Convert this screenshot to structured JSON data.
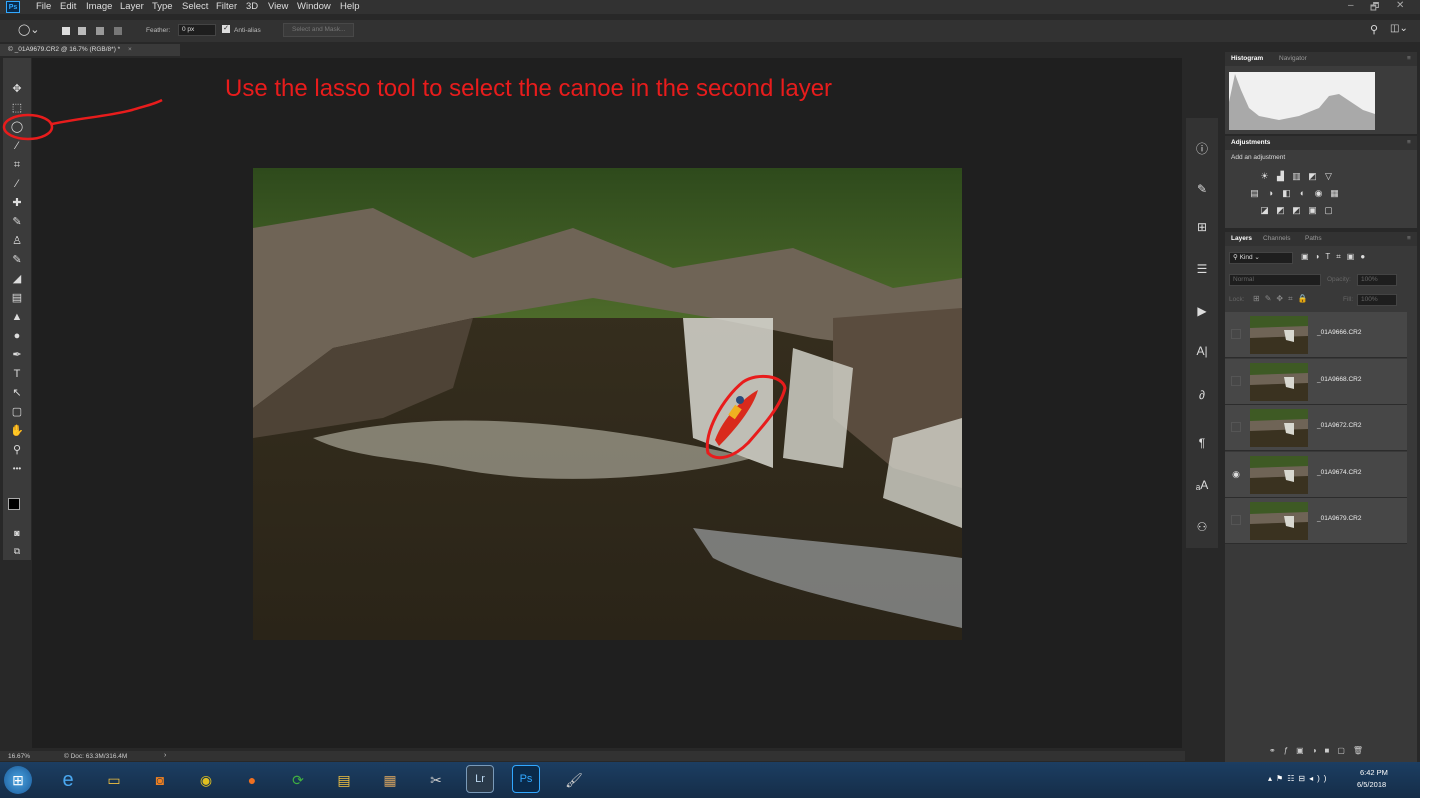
{
  "app": {
    "name": "Ps",
    "menu": [
      "File",
      "Edit",
      "Image",
      "Layer",
      "Type",
      "Select",
      "Filter",
      "3D",
      "View",
      "Window",
      "Help"
    ],
    "window_controls": [
      "–",
      "🗗",
      "✕"
    ]
  },
  "options_bar": {
    "feather_label": "Feather:",
    "feather_value": "0 px",
    "antialias_label": "Anti-alias",
    "antialias_checked": true,
    "select_mask_label": "Select and Mask..."
  },
  "document_tab": {
    "title": "© _01A9679.CR2 @ 16.7% (RGB/8*) *",
    "close": "×"
  },
  "annotation": {
    "text": "Use the lasso tool to select the canoe in the second layer",
    "color": "#e81c1c"
  },
  "toolbox": {
    "tools": [
      {
        "name": "move-tool",
        "glyph": "✥"
      },
      {
        "name": "marquee-tool",
        "glyph": "⬚"
      },
      {
        "name": "lasso-tool",
        "glyph": "◯"
      },
      {
        "name": "magic-wand-tool",
        "glyph": "⁄"
      },
      {
        "name": "crop-tool",
        "glyph": "⌗"
      },
      {
        "name": "eyedropper-tool",
        "glyph": "⁄"
      },
      {
        "name": "healing-brush-tool",
        "glyph": "✚"
      },
      {
        "name": "brush-tool",
        "glyph": "✎"
      },
      {
        "name": "clone-stamp-tool",
        "glyph": "♙"
      },
      {
        "name": "history-brush-tool",
        "glyph": "✎"
      },
      {
        "name": "eraser-tool",
        "glyph": "◢"
      },
      {
        "name": "gradient-tool",
        "glyph": "▤"
      },
      {
        "name": "blur-tool",
        "glyph": "▲"
      },
      {
        "name": "dodge-tool",
        "glyph": "●"
      },
      {
        "name": "pen-tool",
        "glyph": "✒"
      },
      {
        "name": "type-tool",
        "glyph": "T"
      },
      {
        "name": "path-selection-tool",
        "glyph": "↖"
      },
      {
        "name": "shape-tool",
        "glyph": "▢"
      },
      {
        "name": "hand-tool",
        "glyph": "✋"
      },
      {
        "name": "zoom-tool",
        "glyph": "⚲"
      },
      {
        "name": "more-tools",
        "glyph": "•••"
      }
    ]
  },
  "panels": {
    "histogram_tabs": [
      "Histogram",
      "Navigator"
    ],
    "adjustments_title": "Adjustments",
    "adjustments_subtitle": "Add an adjustment",
    "layers_tabs": [
      "Layers",
      "Channels",
      "Paths"
    ],
    "kind_label": "Kind",
    "blend_mode": "Normal",
    "opacity_label": "Opacity:",
    "opacity_value": "100%",
    "lock_label": "Lock:",
    "fill_label": "Fill:",
    "fill_value": "100%",
    "layers": [
      {
        "name": "_01A9666.CR2",
        "visible": false
      },
      {
        "name": "_01A9668.CR2",
        "visible": false
      },
      {
        "name": "_01A9672.CR2",
        "visible": false
      },
      {
        "name": "_01A9674.CR2",
        "visible": true
      },
      {
        "name": "_01A9679.CR2",
        "visible": false
      }
    ]
  },
  "status_bar": {
    "zoom": "16.67%",
    "doc": "© Doc: 63.3M/316.4M"
  },
  "taskbar": {
    "apps": [
      "Lr",
      "Ps"
    ],
    "time": "6:42 PM",
    "date": "6/5/2018"
  }
}
